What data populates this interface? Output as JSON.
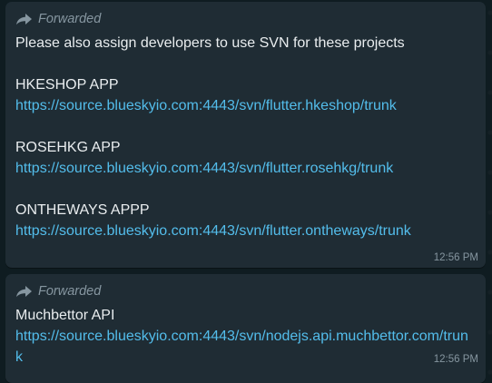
{
  "messages": [
    {
      "forwarded_label": "Forwarded",
      "intro": "Please also assign developers to use SVN for these projects",
      "projects": [
        {
          "name": "HKESHOP APP",
          "url": "https://source.blueskyio.com:4443/svn/flutter.hkeshop/trunk"
        },
        {
          "name": "ROSEHKG APP",
          "url": "https://source.blueskyio.com:4443/svn/flutter.rosehkg/trunk"
        },
        {
          "name": "ONTHEWAYS APPP",
          "url": "https://source.blueskyio.com:4443/svn/flutter.ontheways/trunk"
        }
      ],
      "time": "12:56 PM"
    },
    {
      "forwarded_label": "Forwarded",
      "name": "Muchbettor API",
      "url": "https://source.blueskyio.com:4443/svn/nodejs.api.muchbettor.com/trunk",
      "time": "12:56 PM"
    }
  ],
  "icons": {
    "forward": "forward-arrow-icon"
  },
  "colors": {
    "background": "#0f1c21",
    "bubble": "#1f2c34",
    "text": "#e9edef",
    "muted": "#8696a0",
    "link": "#53bdeb"
  }
}
